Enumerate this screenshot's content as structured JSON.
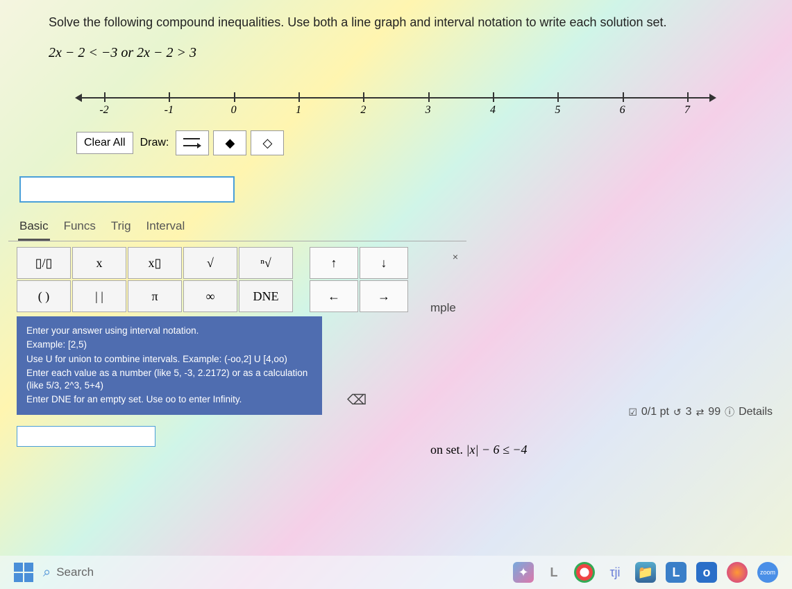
{
  "question": {
    "instructions": "Solve the following compound inequalities. Use both a line graph and interval notation to write each solution set.",
    "inequality_display": "2x − 2 < −3  or  2x − 2 > 3"
  },
  "numberline": {
    "ticks": [
      "-2",
      "-1",
      "0",
      "1",
      "2",
      "3",
      "4",
      "5",
      "6",
      "7"
    ]
  },
  "tools": {
    "clear_all": "Clear All",
    "draw_label": "Draw:"
  },
  "calc": {
    "tabs": [
      "Basic",
      "Funcs",
      "Trig",
      "Interval"
    ],
    "active_tab": "Basic",
    "keys_row1": [
      "▯/▯",
      "x",
      "x▯",
      "√",
      "ⁿ√"
    ],
    "nav_row1": [
      "↑",
      "↓"
    ],
    "keys_row2": [
      "( )",
      "| |",
      "π",
      "∞",
      "DNE"
    ],
    "nav_row2": [
      "←",
      "→"
    ],
    "close": "×",
    "backspace": "⌫"
  },
  "help": {
    "l1": "Enter your answer using interval notation.",
    "l2": "Example: [2,5)",
    "l3": "Use U for union to combine intervals. Example: (-oo,2] U [4,oo)",
    "l4": "Enter each value as a number (like 5, -3, 2.2172) or as a calculation (like 5/3, 2^3, 5+4)",
    "l5": "Enter DNE for an empty set. Use oo to enter Infinity."
  },
  "right": {
    "mple": "mple",
    "points": "0/1 pt",
    "retry": "3",
    "tries": "99",
    "details": "Details",
    "onset_prefix": "on set.",
    "onset_math": "|x| − 6 ≤ −4"
  },
  "taskbar": {
    "search_placeholder": "Search"
  }
}
